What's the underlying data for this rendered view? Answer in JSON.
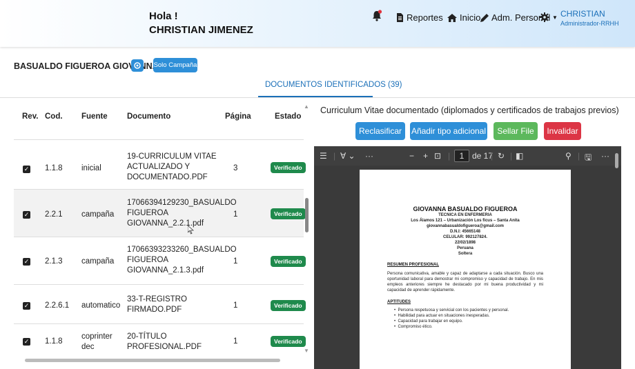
{
  "header": {
    "greeting": "Hola !",
    "user_full_name": "CHRISTIAN JIMENEZ",
    "nav": {
      "reportes": "Reportes",
      "inicio": "Inicio",
      "adm_personal": "Adm. Personal"
    },
    "user_name": "CHRISTIAN",
    "user_role": "Administrador-RRHH"
  },
  "person_name": "BASUALDO FIGUEROA GIOVANNA",
  "solo_campana_label": "Solo Campaña",
  "tab_title": "DOCUMENTOS IDENTIFICADOS (39)",
  "table": {
    "headers": {
      "rev": "Rev.",
      "cod": "Cod.",
      "fuente": "Fuente",
      "documento": "Documento",
      "pagina": "Página",
      "estado": "Estado"
    },
    "rows": [
      {
        "cod": "1.1.8",
        "fuente": "inicial",
        "doc1": "19-CURRICULUM VITAE",
        "doc2": "ACTUALIZADO Y",
        "doc3": "DOCUMENTADO.PDF",
        "pagina": "3",
        "estado": "Verificado"
      },
      {
        "cod": "2.2.1",
        "fuente": "campaña",
        "doc1": "17066394129230_BASUALDO",
        "doc2": "FIGUEROA",
        "doc3": "GIOVANNA_2.2.1.pdf",
        "pagina": "1",
        "estado": "Verificado"
      },
      {
        "cod": "2.1.3",
        "fuente": "campaña",
        "doc1": "17066393233260_BASUALDO",
        "doc2": "FIGUEROA",
        "doc3": "GIOVANNA_2.1.3.pdf",
        "pagina": "1",
        "estado": "Verificado"
      },
      {
        "cod": "2.2.6.1",
        "fuente": "automatico",
        "doc1": "33-T-REGISTRO",
        "doc2": "FIRMADO.PDF",
        "doc3": "",
        "pagina": "1",
        "estado": "Verificado"
      },
      {
        "cod": "1.1.8",
        "fuente": "coprinter",
        "fuente2": "dec",
        "doc1": "20-TÍTULO",
        "doc2": "PROFESIONAL.PDF",
        "doc3": "",
        "pagina": "1",
        "estado": "Verificado"
      }
    ]
  },
  "document_title": "Curriculum Vitae documentado (diplomados y certificados de trabajos previos)",
  "actions": {
    "reclasificar": "Reclasificar",
    "anadir": "Añadir tipo adicional",
    "sellar": "Sellar File",
    "invalidar": "Invalidar"
  },
  "colors": {
    "primary": "#2e8fd8",
    "success": "#5cb85c",
    "danger": "#dc3545",
    "badge": "#1f8a4c",
    "link": "#1a6fb8"
  },
  "viewer": {
    "page_input": "1",
    "page_total": "de 17"
  },
  "pdf": {
    "name": "GIOVANNA BASUALDO FIGUEROA",
    "title": "TECNICA EN ENFERMERIA",
    "address": "Los Álamos 121 – Urbanización Los ficus – Santa Anita",
    "email": "giovannabasualdofigueroa@gmail.com",
    "dni": "D.N.I: 45665148",
    "celular": "CELULAR: 992127824.",
    "fecha": "22/02/1898",
    "nacionalidad": "Peruana",
    "estado_civil": "Soltera",
    "resumen_title": "RESUMEN PROFESIONAL",
    "resumen_text": "Persona comunicativa, amable y capaz de adaptarse a cada situación. Busco una oportunidad laboral para demostrar mi compromiso y capacidad de trabajo. En mis empleos anteriores siempre he destacado por mi buena productividad y mi capacidad de aprender rápidamente.",
    "aptitudes_title": "APTITUDES",
    "aptitudes": [
      "Persona respetuosa y servicial con los pacientes y personal.",
      "Habilidad para actuar en situaciones inesperadas.",
      "Capacidad para trabajar en equipo.",
      "Compromiso ético."
    ]
  }
}
